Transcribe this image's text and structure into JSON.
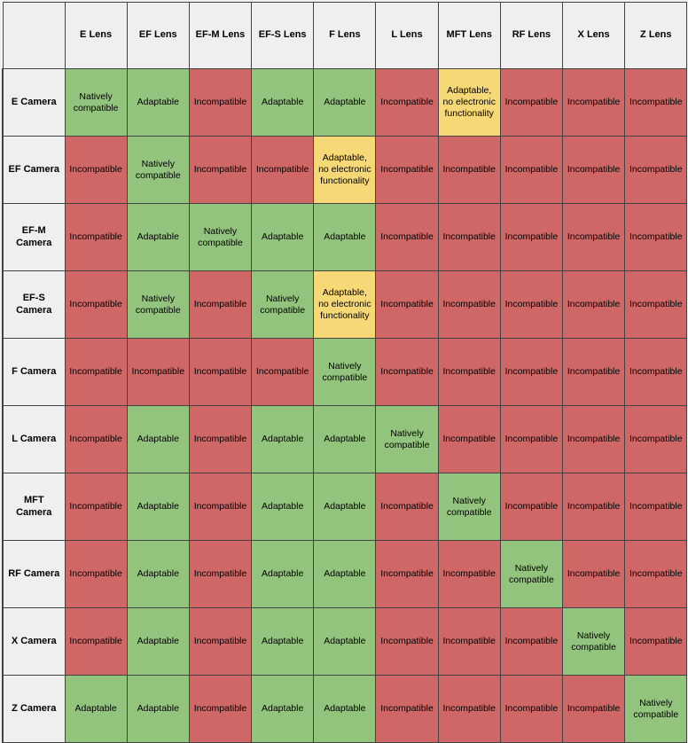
{
  "table": {
    "corner_label": "",
    "column_headers": [
      "E Lens",
      "EF Lens",
      "EF-M Lens",
      "EF-S Lens",
      "F Lens",
      "L Lens",
      "MFT Lens",
      "RF Lens",
      "X Lens",
      "Z Lens"
    ],
    "row_headers": [
      "E Camera",
      "EF Camera",
      "EF-M Camera",
      "EF-S Camera",
      "F Camera",
      "L Camera",
      "MFT Camera",
      "RF Camera",
      "X Camera",
      "Z Camera"
    ],
    "status_labels": {
      "native": "Natively compatible",
      "adaptable": "Adaptable",
      "noelec": "Adaptable, no electronic functionality",
      "incompatible": "Incompatible"
    },
    "colors": {
      "native": "#93c47d",
      "adaptable": "#93c47d",
      "noelec": "#f6d976",
      "incompatible": "#d06767",
      "header_bg": "#efefef",
      "border": "#434343",
      "page_bg": "#f2f2f2"
    },
    "rows": [
      {
        "header": "E Camera",
        "cells": [
          {
            "status": "native",
            "text": "Natively compatible"
          },
          {
            "status": "adaptable",
            "text": "Adaptable"
          },
          {
            "status": "incompatible",
            "text": "Incompatible"
          },
          {
            "status": "adaptable",
            "text": "Adaptable"
          },
          {
            "status": "adaptable",
            "text": "Adaptable"
          },
          {
            "status": "incompatible",
            "text": "Incompatible"
          },
          {
            "status": "noelec",
            "text": "Adaptable, no electronic functionality"
          },
          {
            "status": "incompatible",
            "text": "Incompatible"
          },
          {
            "status": "incompatible",
            "text": "Incompatible"
          },
          {
            "status": "incompatible",
            "text": "Incompatible"
          }
        ]
      },
      {
        "header": "EF Camera",
        "cells": [
          {
            "status": "incompatible",
            "text": "Incompatible"
          },
          {
            "status": "native",
            "text": "Natively compatible"
          },
          {
            "status": "incompatible",
            "text": "Incompatible"
          },
          {
            "status": "incompatible",
            "text": "Incompatible"
          },
          {
            "status": "noelec",
            "text": "Adaptable, no electronic functionality"
          },
          {
            "status": "incompatible",
            "text": "Incompatible"
          },
          {
            "status": "incompatible",
            "text": "Incompatible"
          },
          {
            "status": "incompatible",
            "text": "Incompatible"
          },
          {
            "status": "incompatible",
            "text": "Incompatible"
          },
          {
            "status": "incompatible",
            "text": "Incompatible"
          }
        ]
      },
      {
        "header": "EF-M Camera",
        "cells": [
          {
            "status": "incompatible",
            "text": "Incompatible"
          },
          {
            "status": "adaptable",
            "text": "Adaptable"
          },
          {
            "status": "native",
            "text": "Natively compatible"
          },
          {
            "status": "adaptable",
            "text": "Adaptable"
          },
          {
            "status": "adaptable",
            "text": "Adaptable"
          },
          {
            "status": "incompatible",
            "text": "Incompatible"
          },
          {
            "status": "incompatible",
            "text": "Incompatible"
          },
          {
            "status": "incompatible",
            "text": "Incompatible"
          },
          {
            "status": "incompatible",
            "text": "Incompatible"
          },
          {
            "status": "incompatible",
            "text": "Incompatible"
          }
        ]
      },
      {
        "header": "EF-S Camera",
        "cells": [
          {
            "status": "incompatible",
            "text": "Incompatible"
          },
          {
            "status": "native",
            "text": "Natively compatible"
          },
          {
            "status": "incompatible",
            "text": "Incompatible"
          },
          {
            "status": "native",
            "text": "Natively compatible"
          },
          {
            "status": "noelec",
            "text": "Adaptable, no electronic functionality"
          },
          {
            "status": "incompatible",
            "text": "Incompatible"
          },
          {
            "status": "incompatible",
            "text": "Incompatible"
          },
          {
            "status": "incompatible",
            "text": "Incompatible"
          },
          {
            "status": "incompatible",
            "text": "Incompatible"
          },
          {
            "status": "incompatible",
            "text": "Incompatible"
          }
        ]
      },
      {
        "header": "F Camera",
        "cells": [
          {
            "status": "incompatible",
            "text": "Incompatible"
          },
          {
            "status": "incompatible",
            "text": "Incompatible"
          },
          {
            "status": "incompatible",
            "text": "Incompatible"
          },
          {
            "status": "incompatible",
            "text": "Incompatible"
          },
          {
            "status": "native",
            "text": "Natively compatible"
          },
          {
            "status": "incompatible",
            "text": "Incompatible"
          },
          {
            "status": "incompatible",
            "text": "Incompatible"
          },
          {
            "status": "incompatible",
            "text": "Incompatible"
          },
          {
            "status": "incompatible",
            "text": "Incompatible"
          },
          {
            "status": "incompatible",
            "text": "Incompatible"
          }
        ]
      },
      {
        "header": "L Camera",
        "cells": [
          {
            "status": "incompatible",
            "text": "Incompatible"
          },
          {
            "status": "adaptable",
            "text": "Adaptable"
          },
          {
            "status": "incompatible",
            "text": "Incompatible"
          },
          {
            "status": "adaptable",
            "text": "Adaptable"
          },
          {
            "status": "adaptable",
            "text": "Adaptable"
          },
          {
            "status": "native",
            "text": "Natively compatible"
          },
          {
            "status": "incompatible",
            "text": "Incompatible"
          },
          {
            "status": "incompatible",
            "text": "Incompatible"
          },
          {
            "status": "incompatible",
            "text": "Incompatible"
          },
          {
            "status": "incompatible",
            "text": "Incompatible"
          }
        ]
      },
      {
        "header": "MFT Camera",
        "cells": [
          {
            "status": "incompatible",
            "text": "Incompatible"
          },
          {
            "status": "adaptable",
            "text": "Adaptable"
          },
          {
            "status": "incompatible",
            "text": "Incompatible"
          },
          {
            "status": "adaptable",
            "text": "Adaptable"
          },
          {
            "status": "adaptable",
            "text": "Adaptable"
          },
          {
            "status": "incompatible",
            "text": "Incompatible"
          },
          {
            "status": "native",
            "text": "Natively compatible"
          },
          {
            "status": "incompatible",
            "text": "Incompatible"
          },
          {
            "status": "incompatible",
            "text": "Incompatible"
          },
          {
            "status": "incompatible",
            "text": "Incompatible"
          }
        ]
      },
      {
        "header": "RF Camera",
        "cells": [
          {
            "status": "incompatible",
            "text": "Incompatible"
          },
          {
            "status": "adaptable",
            "text": "Adaptable"
          },
          {
            "status": "incompatible",
            "text": "Incompatible"
          },
          {
            "status": "adaptable",
            "text": "Adaptable"
          },
          {
            "status": "adaptable",
            "text": "Adaptable"
          },
          {
            "status": "incompatible",
            "text": "Incompatible"
          },
          {
            "status": "incompatible",
            "text": "Incompatible"
          },
          {
            "status": "native",
            "text": "Natively compatible"
          },
          {
            "status": "incompatible",
            "text": "Incompatible"
          },
          {
            "status": "incompatible",
            "text": "Incompatible"
          }
        ]
      },
      {
        "header": "X Camera",
        "cells": [
          {
            "status": "incompatible",
            "text": "Incompatible"
          },
          {
            "status": "adaptable",
            "text": "Adaptable"
          },
          {
            "status": "incompatible",
            "text": "Incompatible"
          },
          {
            "status": "adaptable",
            "text": "Adaptable"
          },
          {
            "status": "adaptable",
            "text": "Adaptable"
          },
          {
            "status": "incompatible",
            "text": "Incompatible"
          },
          {
            "status": "incompatible",
            "text": "Incompatible"
          },
          {
            "status": "incompatible",
            "text": "Incompatible"
          },
          {
            "status": "native",
            "text": "Natively compatible"
          },
          {
            "status": "incompatible",
            "text": "Incompatible"
          }
        ]
      },
      {
        "header": "Z Camera",
        "cells": [
          {
            "status": "adaptable",
            "text": "Adaptable"
          },
          {
            "status": "adaptable",
            "text": "Adaptable"
          },
          {
            "status": "incompatible",
            "text": "Incompatible"
          },
          {
            "status": "adaptable",
            "text": "Adaptable"
          },
          {
            "status": "adaptable",
            "text": "Adaptable"
          },
          {
            "status": "incompatible",
            "text": "Incompatible"
          },
          {
            "status": "incompatible",
            "text": "Incompatible"
          },
          {
            "status": "incompatible",
            "text": "Incompatible"
          },
          {
            "status": "incompatible",
            "text": "Incompatible"
          },
          {
            "status": "native",
            "text": "Natively compatible"
          }
        ]
      }
    ]
  }
}
